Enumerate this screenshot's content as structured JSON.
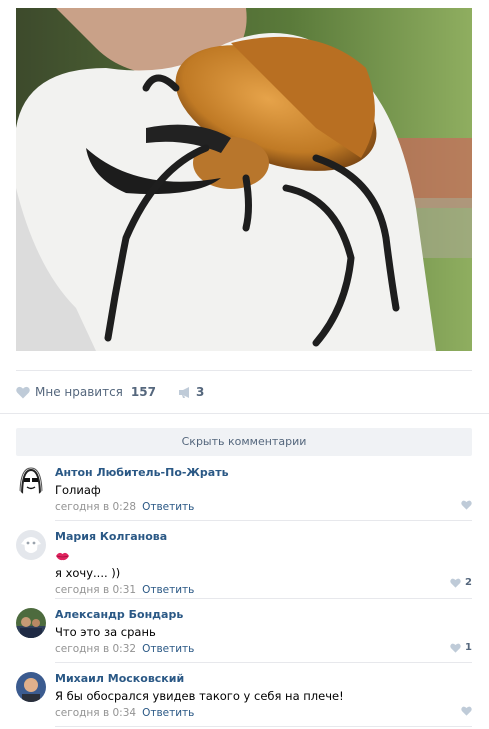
{
  "post": {
    "likes": {
      "label": "Мне нравится",
      "count": "157",
      "icon": "heart-icon"
    },
    "shares": {
      "count": "3",
      "icon": "megaphone-icon"
    }
  },
  "comments_toggle": {
    "label": "Скрыть комментарии"
  },
  "comments": [
    {
      "author": "Антон Любитель-По-Жрать",
      "text": "Голиаф",
      "time": "сегодня в 0:28",
      "reply": "Ответить",
      "likes": ""
    },
    {
      "author": "Мария Колганова",
      "text": "я хочу.... ))",
      "emoji": "kiss-lips-emoji",
      "time": "сегодня в 0:31",
      "reply": "Ответить",
      "likes": "2"
    },
    {
      "author": "Александр Бондарь",
      "text": "Что это за срань",
      "time": "сегодня в 0:32",
      "reply": "Ответить",
      "likes": "1"
    },
    {
      "author": "Михаил Московский",
      "text": "Я бы обосрался увидев такого у себя на плече!",
      "time": "сегодня в 0:34",
      "reply": "Ответить",
      "likes": ""
    }
  ],
  "colors": {
    "link": "#2a5885",
    "muted": "#939393",
    "divider": "#e7e8ec",
    "button_bg": "#f0f2f5"
  }
}
